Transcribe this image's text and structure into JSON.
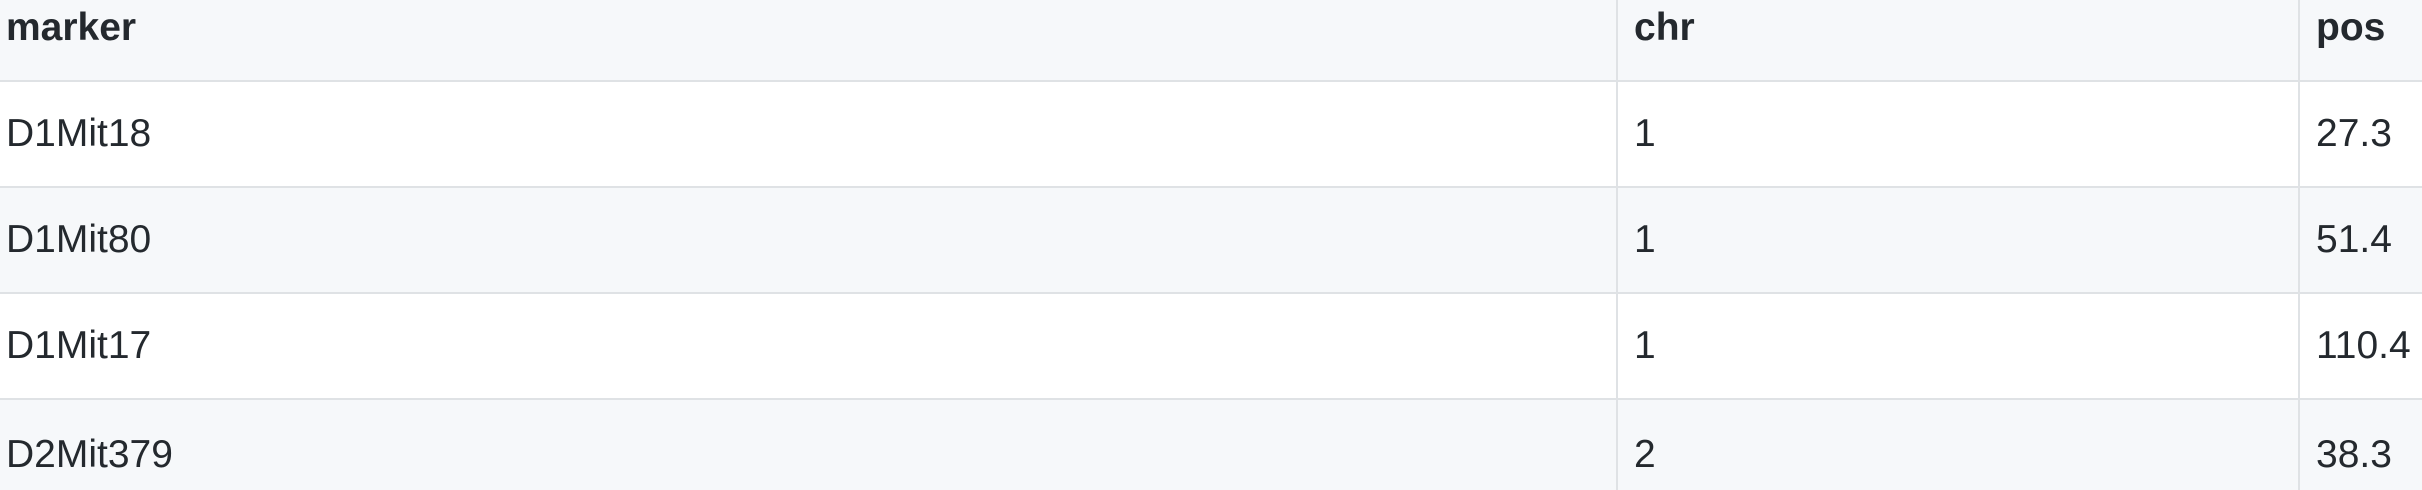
{
  "columns": [
    "marker",
    "chr",
    "pos"
  ],
  "rows": [
    {
      "marker": "D1Mit18",
      "chr": "1",
      "pos": "27.3"
    },
    {
      "marker": "D1Mit80",
      "chr": "1",
      "pos": "51.4"
    },
    {
      "marker": "D1Mit17",
      "chr": "1",
      "pos": "110.4"
    },
    {
      "marker": "D2Mit379",
      "chr": "2",
      "pos": "38.3"
    }
  ],
  "colors": {
    "border": "#dfe2e5",
    "stripe": "#f6f8fa",
    "text": "#24292e"
  }
}
